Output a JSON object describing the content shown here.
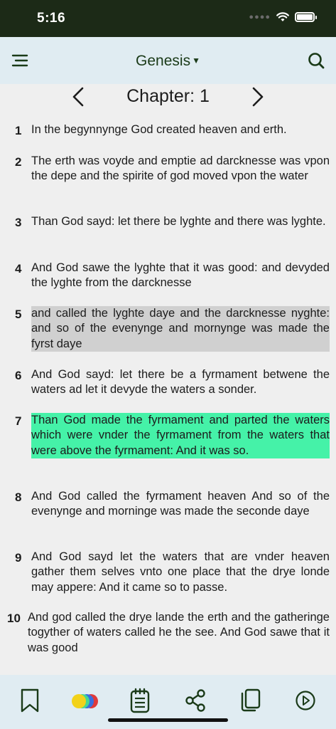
{
  "status": {
    "time": "5:16"
  },
  "header": {
    "book": "Genesis",
    "caret": "▼"
  },
  "chapter": {
    "label": "Chapter: 1"
  },
  "verses": [
    {
      "num": "1",
      "text": "In the begynnynge God created heaven and erth."
    },
    {
      "num": "2",
      "text": "The erth was voyde and emptie ad darcknesse was vpon the depe and the spirite of god moved vpon the water"
    },
    {
      "num": "3",
      "text": "Than God sayd: let there be lyghte and there was lyghte."
    },
    {
      "num": "4",
      "text": "And God sawe the lyghte that it was good: and devyded the lyghte from the darcknesse"
    },
    {
      "num": "5",
      "text": "and called the lyghte daye and the darcknesse nyghte: and so of the evenynge and mornynge was made the fyrst daye",
      "highlight": "gray"
    },
    {
      "num": "6",
      "text": "And God sayd: let there be a fyrmament betwene the waters ad let it devyde the waters a sonder."
    },
    {
      "num": "7",
      "text": "Than God made the fyrmament and parted the waters which were vnder the fyrmament from the waters that were above the fyrmament: And it was so.",
      "highlight": "green"
    },
    {
      "num": "8",
      "text": "And God called the fyrmament heaven And so of the evenynge and morninge was made the seconde daye"
    },
    {
      "num": "9",
      "text": "And God sayd let the waters that are vnder heaven gather them selves vnto one place that the drye londe may appere: And it came so to passe."
    },
    {
      "num": "10",
      "text": "And god called the drye lande the erth and the gatheringe togyther of waters called he the see. And God sawe that it was good"
    }
  ],
  "colors": {
    "status_bar": "#1c2a17",
    "toolbar": "#e0ecf2",
    "accent": "#1a3a18",
    "highlight_gray": "#d0d0d0",
    "highlight_green": "#45f2a8"
  },
  "toolbar_icons": [
    "bookmark-icon",
    "color-palette-icon",
    "notes-icon",
    "share-icon",
    "copy-icon",
    "play-icon"
  ]
}
